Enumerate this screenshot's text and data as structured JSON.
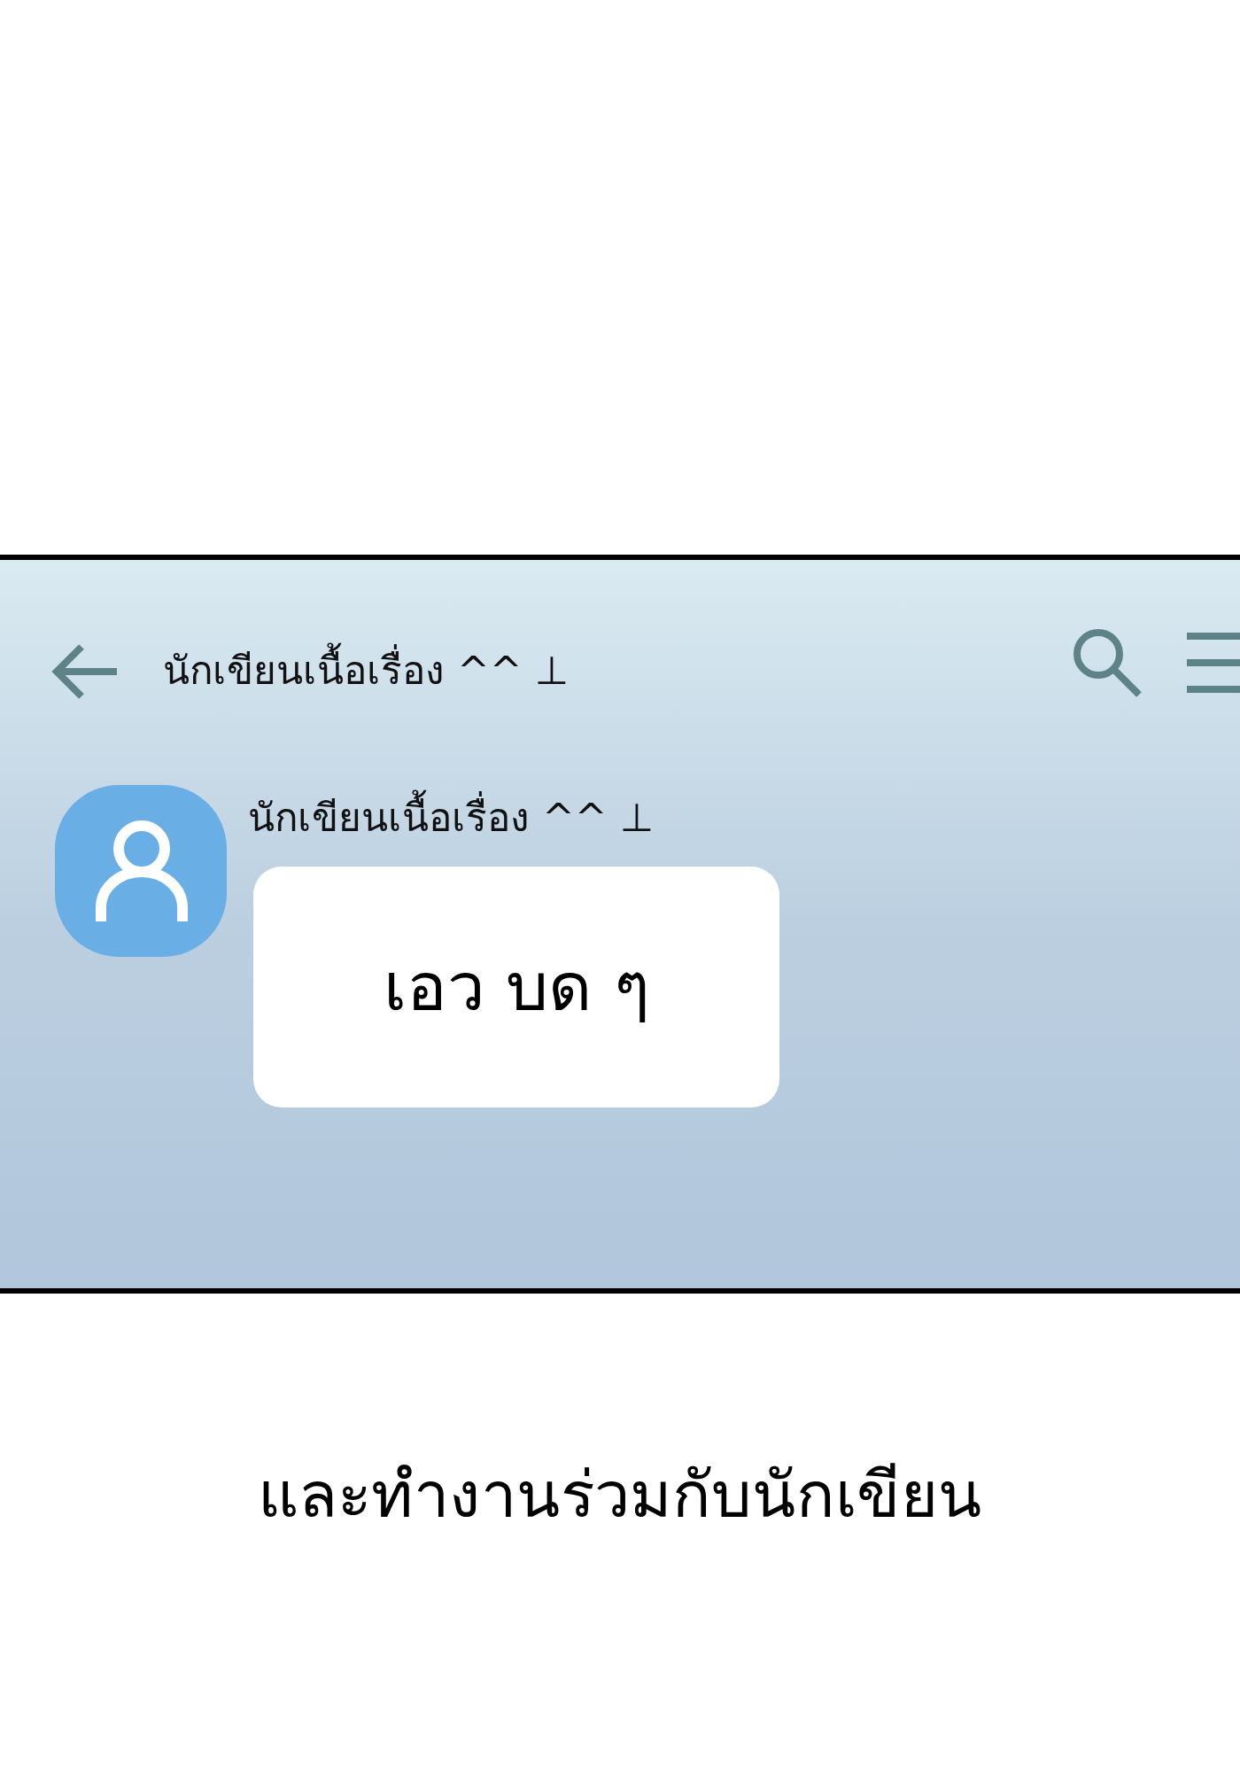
{
  "header": {
    "title": "นักเขียนเนื้อเรื่อง ^^ ⊥"
  },
  "messages": [
    {
      "sender": "นักเขียนเนื้อเรื่อง ^^ ⊥",
      "text": "เอว บด ๆ"
    }
  ],
  "caption": "และทำงานร่วมกับนักเขียน"
}
